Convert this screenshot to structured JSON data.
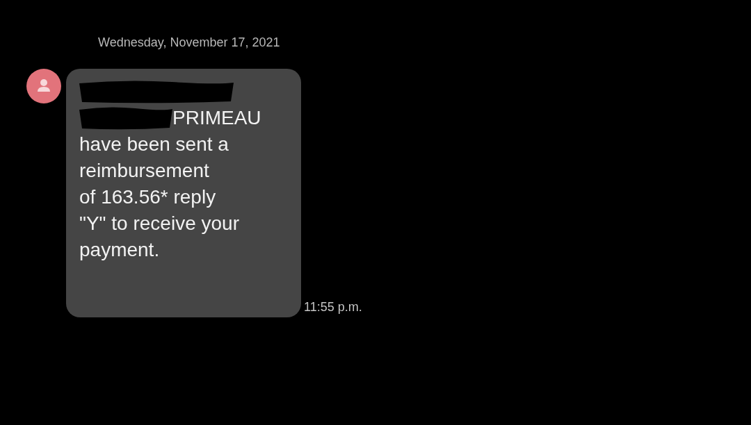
{
  "date_header": "Wednesday, November 17, 2021",
  "message": {
    "lines": [
      {
        "kind": "redacted"
      },
      {
        "kind": "redacted_prefix",
        "text": "PRIMEAU"
      },
      {
        "kind": "text",
        "text": "have been sent a"
      },
      {
        "kind": "text",
        "text": "reimbursement"
      },
      {
        "kind": "text",
        "text": "of 163.56* reply"
      },
      {
        "kind": "text",
        "text": "\"Y\" to receive your"
      },
      {
        "kind": "text",
        "text": "payment."
      }
    ],
    "time": "11:55 p.m."
  }
}
